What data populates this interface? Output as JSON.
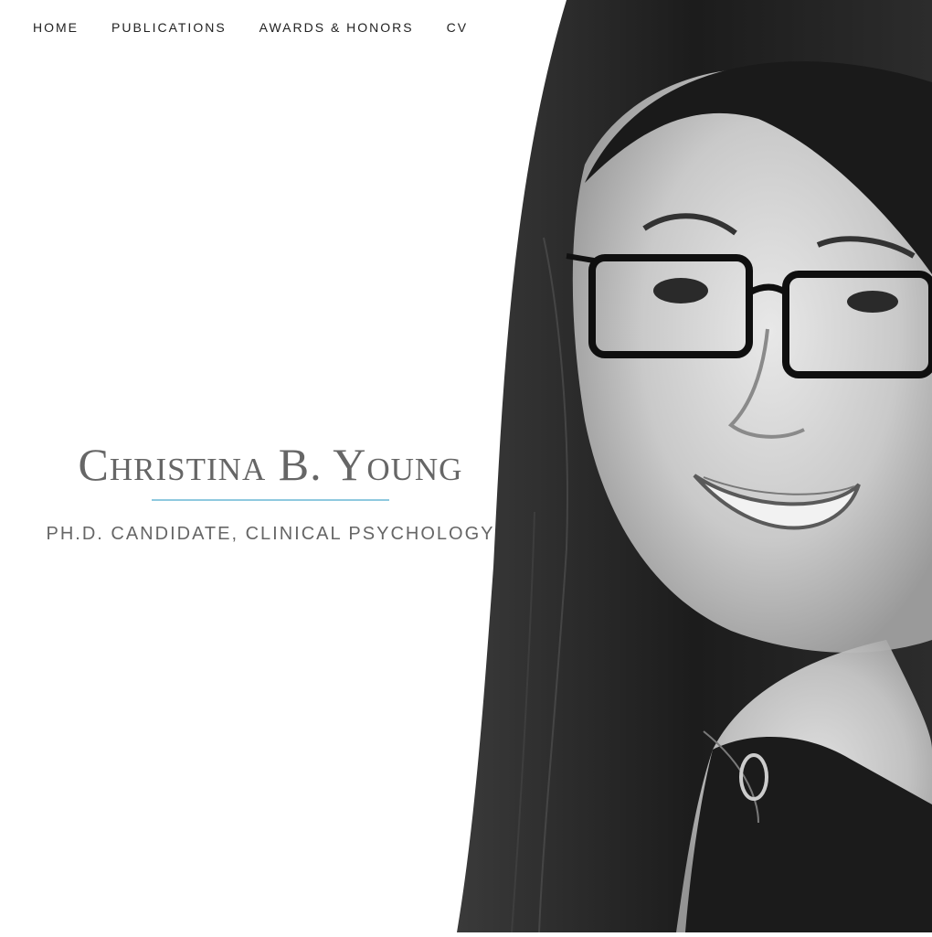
{
  "nav": {
    "items": [
      {
        "label": "HOME"
      },
      {
        "label": "PUBLICATIONS"
      },
      {
        "label": "AWARDS & HONORS"
      },
      {
        "label": "CV"
      }
    ]
  },
  "hero": {
    "name": "Christina B. Young",
    "subtitle": "PH.D. CANDIDATE, CLINICAL PSYCHOLOGY",
    "accent_color": "#8ec9df"
  },
  "portrait": {
    "style": "black-and-white"
  }
}
